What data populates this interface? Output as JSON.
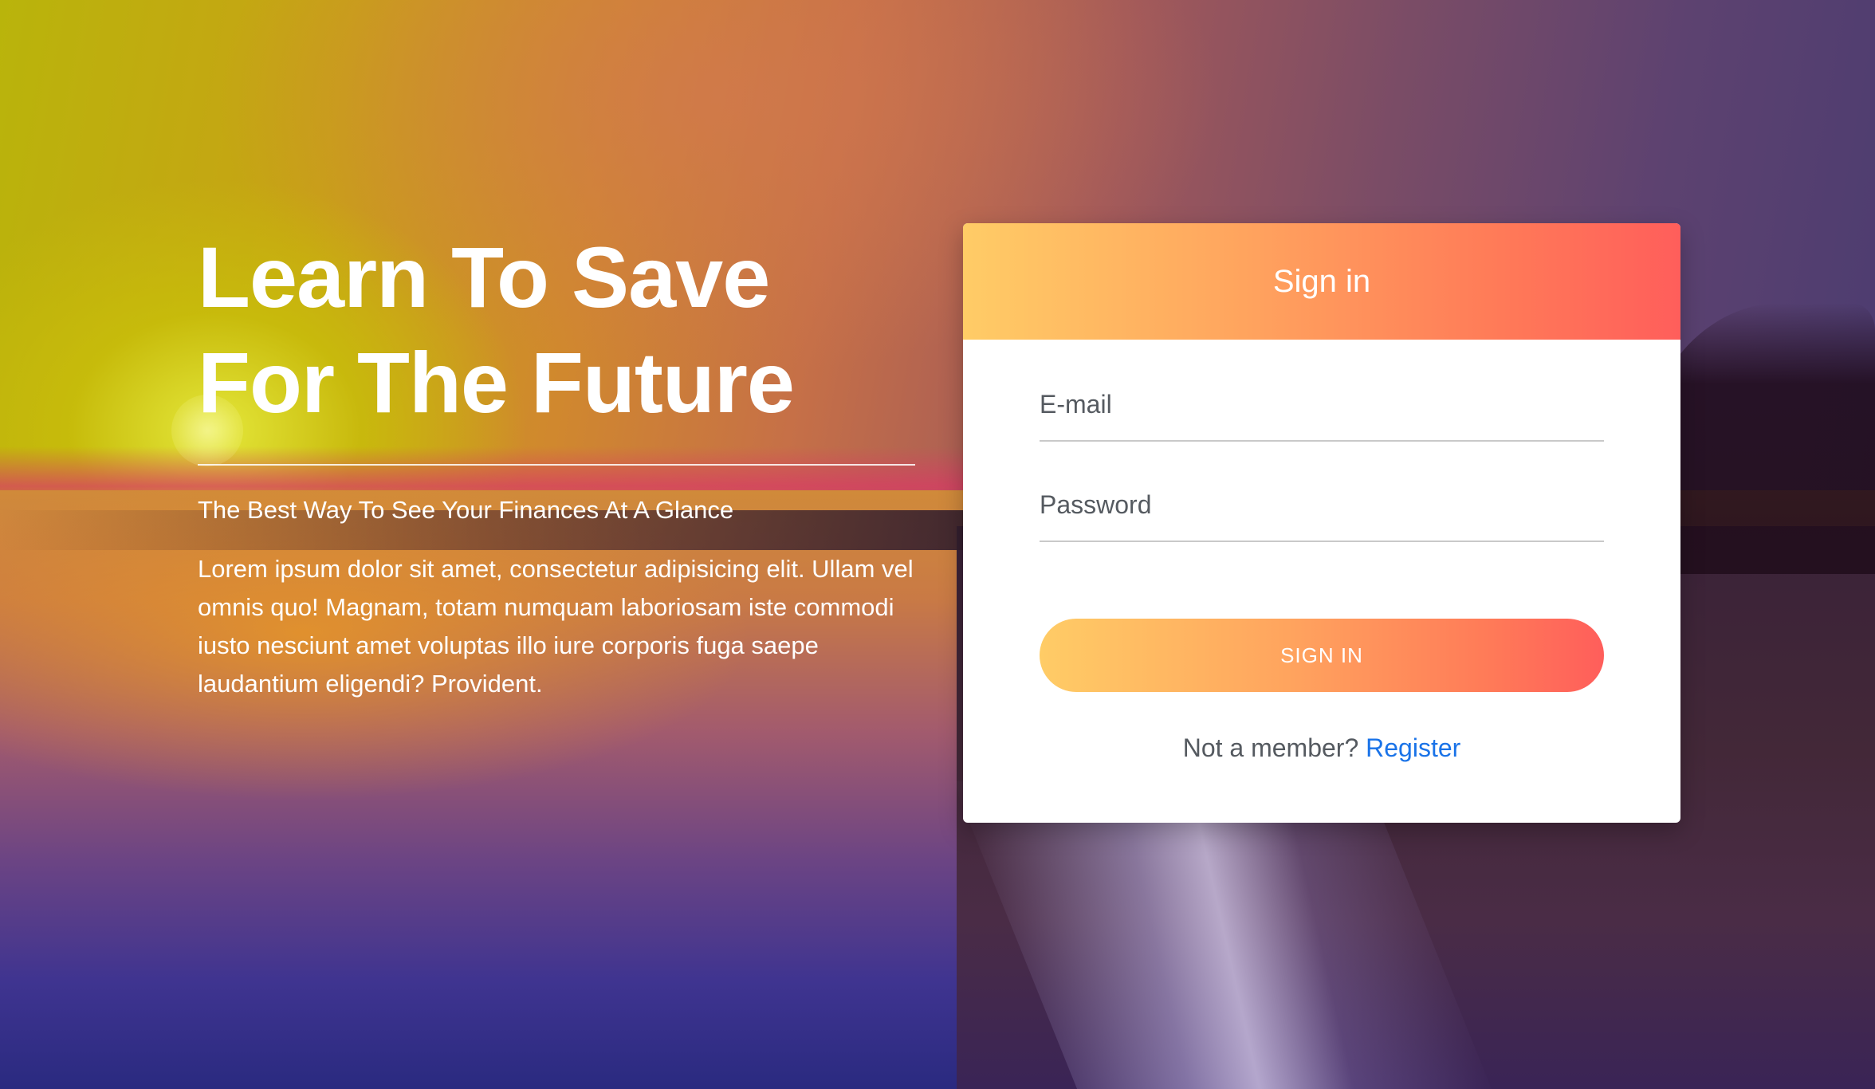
{
  "hero": {
    "title": "Learn To Save For The Future",
    "subtitle": "The Best Way To See Your Finances At A Glance",
    "body": "Lorem ipsum dolor sit amet, consectetur adipisicing elit. Ullam vel omnis quo! Magnam, totam numquam laboriosam iste commodi iusto nesciunt amet voluptas illo iure corporis fuga saepe laudantium eligendi? Provident."
  },
  "signin": {
    "title": "Sign in",
    "email_placeholder": "E-mail",
    "password_placeholder": "Password",
    "button_label": "SIGN IN",
    "register_prompt": "Not a member?",
    "register_link": "Register"
  },
  "colors": {
    "gradient_start": "#ffcc66",
    "gradient_end": "#ff5e5b",
    "link": "#1a73e8",
    "muted_text": "#555a60"
  }
}
